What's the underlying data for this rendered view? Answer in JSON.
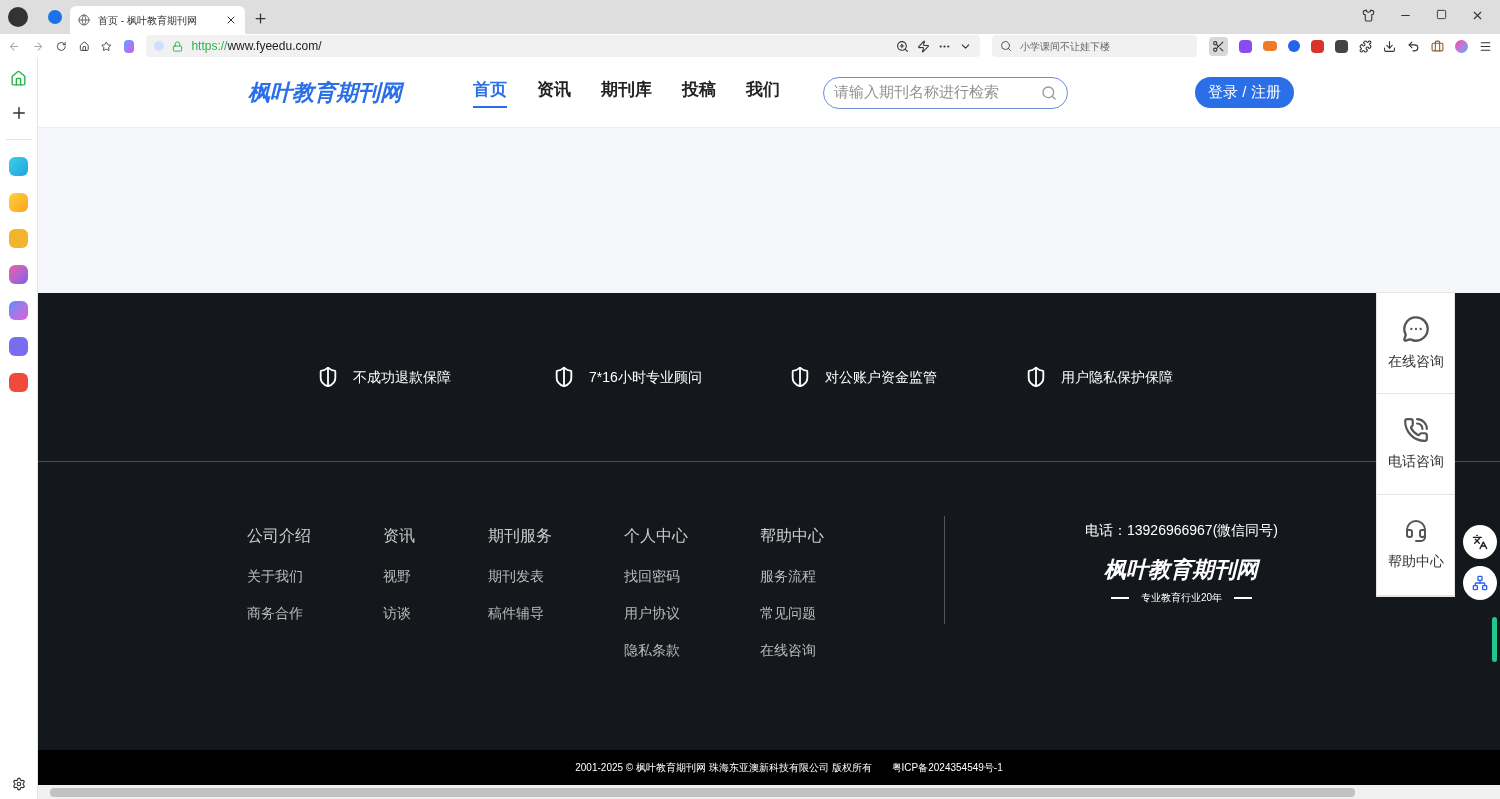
{
  "browser": {
    "tabs": [
      {
        "title": "首页 - 枫叶教育期刊网",
        "selected": true
      }
    ],
    "url_scheme": "https://",
    "url_rest": "www.fyeedu.com/",
    "search_placeholder": "小学课间不让娃下楼"
  },
  "header": {
    "logo": "枫叶教育期刊网",
    "nav": [
      {
        "label": "首页",
        "selected": true
      },
      {
        "label": "资讯",
        "selected": false
      },
      {
        "label": "期刊库",
        "selected": false
      },
      {
        "label": "投稿",
        "selected": false
      },
      {
        "label": "我们",
        "selected": false
      }
    ],
    "search": {
      "placeholder": "请输入期刊名称进行检索"
    },
    "login_button": "登录 / 注册"
  },
  "guarantees": [
    "不成功退款保障",
    "7*16小时专业顾问",
    "对公账户资金监管",
    "用户隐私保护保障"
  ],
  "footer": {
    "columns": [
      {
        "title": "公司介绍",
        "links": [
          "关于我们",
          "商务合作"
        ]
      },
      {
        "title": "资讯",
        "links": [
          "视野",
          "访谈"
        ]
      },
      {
        "title": "期刊服务",
        "links": [
          "期刊发表",
          "稿件辅导"
        ]
      },
      {
        "title": "个人中心",
        "links": [
          "找回密码",
          "用户协议",
          "隐私条款"
        ]
      },
      {
        "title": "帮助中心",
        "links": [
          "服务流程",
          "常见问题",
          "在线咨询"
        ]
      }
    ],
    "phone": "电话：13926966967(微信同号)",
    "logo": "枫叶教育期刊网",
    "slogan": "专业教育行业20年",
    "copyright": "2001-2025 © 枫叶教育期刊网 珠海东亚澳新科技有限公司 版权所有",
    "icp": "粤ICP备2024354549号-1"
  },
  "float_panel": [
    {
      "kind": "chat",
      "label": "在线咨询"
    },
    {
      "kind": "phone",
      "label": "电话咨询"
    },
    {
      "kind": "help",
      "label": "帮助中心"
    }
  ]
}
